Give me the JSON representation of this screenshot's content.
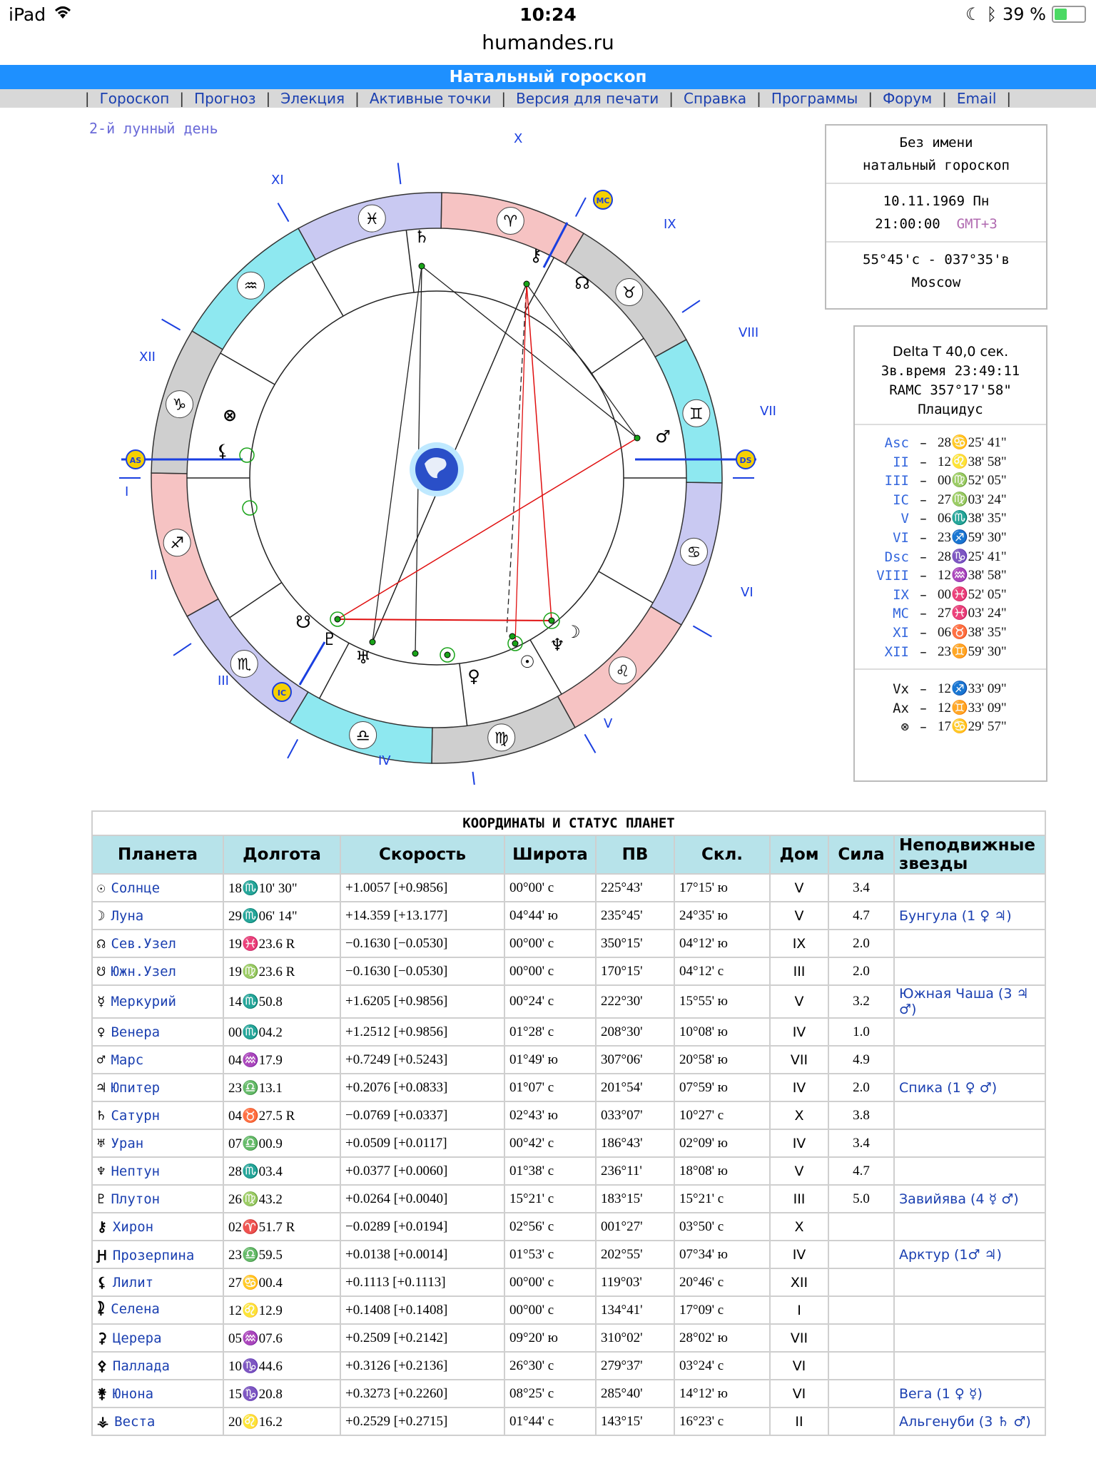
{
  "status_bar": {
    "device": "iPad",
    "time": "10:24",
    "battery": "39 %",
    "battery_level": 0.39
  },
  "browser": {
    "url": "humandes.ru"
  },
  "page": {
    "title": "Натальный гороскоп"
  },
  "nav": [
    "Гороскоп",
    "Прогноз",
    "Элекция",
    "Активные точки",
    "Версия для печати",
    "Справка",
    "Программы",
    "Форум",
    "Email"
  ],
  "lunar_day": "2-й лунный день",
  "info": {
    "name": "Без имени",
    "chart_type": "натальный гороскоп",
    "date": "10.11.1969 Пн",
    "time": "21:00:00",
    "tz": "GMT+3",
    "coords": "55°45'с - 037°35'в",
    "city": "Moscow"
  },
  "houses_panel": {
    "delta_t": "Delta T   40,0 сек.",
    "sidereal": "Зв.время 23:49:11",
    "ramc": "RAMC 357°17'58\"",
    "system": "Плацидус",
    "cusps": [
      {
        "name": "Asc",
        "deg": "28",
        "sign": "♋",
        "min": "25' 41\""
      },
      {
        "name": "II",
        "deg": "12",
        "sign": "♌",
        "min": "38' 58\""
      },
      {
        "name": "III",
        "deg": "00",
        "sign": "♍",
        "min": "52' 05\""
      },
      {
        "name": "IC",
        "deg": "27",
        "sign": "♍",
        "min": "03' 24\""
      },
      {
        "name": "V",
        "deg": "06",
        "sign": "♏",
        "min": "38' 35\""
      },
      {
        "name": "VI",
        "deg": "23",
        "sign": "♐",
        "min": "59' 30\""
      },
      {
        "name": "Dsc",
        "deg": "28",
        "sign": "♑",
        "min": "25' 41\""
      },
      {
        "name": "VIII",
        "deg": "12",
        "sign": "♒",
        "min": "38' 58\""
      },
      {
        "name": "IX",
        "deg": "00",
        "sign": "♓",
        "min": "52' 05\""
      },
      {
        "name": "MC",
        "deg": "27",
        "sign": "♓",
        "min": "03' 24\""
      },
      {
        "name": "XI",
        "deg": "06",
        "sign": "♉",
        "min": "38' 35\""
      },
      {
        "name": "XII",
        "deg": "23",
        "sign": "♊",
        "min": "59' 30\""
      }
    ],
    "points": [
      {
        "name": "Vx",
        "deg": "12",
        "sign": "♐",
        "min": "33' 09\""
      },
      {
        "name": "Ax",
        "deg": "12",
        "sign": "♊",
        "min": "33' 09\""
      },
      {
        "name": "⊗",
        "deg": "17",
        "sign": "♋",
        "min": "29' 57\""
      }
    ]
  },
  "chart": {
    "houses": [
      "I",
      "II",
      "III",
      "IV",
      "V",
      "VI",
      "VII",
      "VIII",
      "IX",
      "X",
      "XI",
      "XII"
    ],
    "angles": [
      "AS",
      "IC",
      "DS",
      "MC"
    ],
    "zodiac": [
      "♈",
      "♉",
      "♊",
      "♋",
      "♌",
      "♍",
      "♎",
      "♏",
      "♐",
      "♑",
      "♒",
      "♓"
    ],
    "planet_glyphs": [
      "♄",
      "⚷",
      "☊",
      "♂",
      "☽",
      "♆",
      "☉",
      "♀",
      "♅",
      "♇",
      "☋",
      "⚸",
      "⊗"
    ]
  },
  "table": {
    "caption": "КООРДИНАТЫ И СТАТУС ПЛАНЕТ",
    "headers": [
      "Планета",
      "Долгота",
      "Скорость",
      "Широта",
      "ПВ",
      "Скл.",
      "Дом",
      "Сила",
      "Неподвижные звезды"
    ],
    "rows": [
      {
        "glyph": "☉",
        "name": "Солнце",
        "lon": "18♏10' 30\"",
        "speed": "+1.0057  [+0.9856]",
        "lat": "00°00' с",
        "ra": "225°43'",
        "decl": "17°15' ю",
        "house": "V",
        "power": "3.4",
        "star": ""
      },
      {
        "glyph": "☽",
        "name": "Луна",
        "lon": "29♏06' 14\"",
        "speed": "+14.359  [+13.177]",
        "lat": "04°44' ю",
        "ra": "235°45'",
        "decl": "24°35' ю",
        "house": "V",
        "power": "4.7",
        "star": "Бунгула (1 ♀ ♃)"
      },
      {
        "glyph": "☊",
        "name": "Сев.Узел",
        "lon": "19♓23.6  R",
        "speed": "−0.1630  [−0.0530]",
        "lat": "00°00' с",
        "ra": "350°15'",
        "decl": "04°12' ю",
        "house": "IX",
        "power": "2.0",
        "star": ""
      },
      {
        "glyph": "☋",
        "name": "Южн.Узел",
        "lon": "19♍23.6  R",
        "speed": "−0.1630  [−0.0530]",
        "lat": "00°00' с",
        "ra": "170°15'",
        "decl": "04°12' с",
        "house": "III",
        "power": "2.0",
        "star": ""
      },
      {
        "glyph": "☿",
        "name": "Меркурий",
        "lon": "14♏50.8",
        "speed": "+1.6205  [+0.9856]",
        "lat": "00°24' с",
        "ra": "222°30'",
        "decl": "15°55' ю",
        "house": "V",
        "power": "3.2",
        "star": "Южная Чаша (3 ♃ ♂)"
      },
      {
        "glyph": "♀",
        "name": "Венера",
        "lon": "00♏04.2",
        "speed": "+1.2512  [+0.9856]",
        "lat": "01°28' с",
        "ra": "208°30'",
        "decl": "10°08' ю",
        "house": "IV",
        "power": "1.0",
        "star": ""
      },
      {
        "glyph": "♂",
        "name": "Марс",
        "lon": "04♒17.9",
        "speed": "+0.7249  [+0.5243]",
        "lat": "01°49' ю",
        "ra": "307°06'",
        "decl": "20°58' ю",
        "house": "VII",
        "power": "4.9",
        "star": ""
      },
      {
        "glyph": "♃",
        "name": "Юпитер",
        "lon": "23♎13.1",
        "speed": "+0.2076  [+0.0833]",
        "lat": "01°07' с",
        "ra": "201°54'",
        "decl": "07°59' ю",
        "house": "IV",
        "power": "2.0",
        "star": "Спика (1 ♀ ♂)"
      },
      {
        "glyph": "♄",
        "name": "Сатурн",
        "lon": "04♉27.5  R",
        "speed": "−0.0769  [+0.0337]",
        "lat": "02°43' ю",
        "ra": "033°07'",
        "decl": "10°27' с",
        "house": "X",
        "power": "3.8",
        "star": ""
      },
      {
        "glyph": "♅",
        "name": "Уран",
        "lon": "07♎00.9",
        "speed": "+0.0509  [+0.0117]",
        "lat": "00°42' с",
        "ra": "186°43'",
        "decl": "02°09' ю",
        "house": "IV",
        "power": "3.4",
        "star": ""
      },
      {
        "glyph": "♆",
        "name": "Нептун",
        "lon": "28♏03.4",
        "speed": "+0.0377  [+0.0060]",
        "lat": "01°38' с",
        "ra": "236°11'",
        "decl": "18°08' ю",
        "house": "V",
        "power": "4.7",
        "star": ""
      },
      {
        "glyph": "♇",
        "name": "Плутон",
        "lon": "26♍43.2",
        "speed": "+0.0264  [+0.0040]",
        "lat": "15°21' с",
        "ra": "183°15'",
        "decl": "15°21' с",
        "house": "III",
        "power": "5.0",
        "star": "Завийява (4 ☿ ♂)"
      },
      {
        "glyph": "⚷",
        "name": "Хирон",
        "lon": "02♈51.7  R",
        "speed": "−0.0289  [+0.0194]",
        "lat": "02°56' с",
        "ra": "001°27'",
        "decl": "03°50' с",
        "house": "X",
        "power": "",
        "star": ""
      },
      {
        "glyph": "Ԩ",
        "name": "Прозерпина",
        "lon": "23♎59.5",
        "speed": "+0.0138  [+0.0014]",
        "lat": "01°53' с",
        "ra": "202°55'",
        "decl": "07°34' ю",
        "house": "IV",
        "power": "",
        "star": "Арктур (1♂ ♃)"
      },
      {
        "glyph": "⚸",
        "name": "Лилит",
        "lon": "27♋00.4",
        "speed": "+0.1113  [+0.1113]",
        "lat": "00°00' с",
        "ra": "119°03'",
        "decl": "20°46' с",
        "house": "XII",
        "power": "",
        "star": ""
      },
      {
        "glyph": "⯝",
        "name": "Селена",
        "lon": "12♌12.9",
        "speed": "+0.1408  [+0.1408]",
        "lat": "00°00' с",
        "ra": "134°41'",
        "decl": "17°09' с",
        "house": "I",
        "power": "",
        "star": ""
      },
      {
        "glyph": "⚳",
        "name": "Церера",
        "lon": "05♒07.6",
        "speed": "+0.2509  [+0.2142]",
        "lat": "09°20' ю",
        "ra": "310°02'",
        "decl": "28°02' ю",
        "house": "VII",
        "power": "",
        "star": ""
      },
      {
        "glyph": "⚴",
        "name": "Паллада",
        "lon": "10♑44.6",
        "speed": "+0.3126  [+0.2136]",
        "lat": "26°30' с",
        "ra": "279°37'",
        "decl": "03°24' с",
        "house": "VI",
        "power": "",
        "star": ""
      },
      {
        "glyph": "⚵",
        "name": "Юнона",
        "lon": "15♑20.8",
        "speed": "+0.3273  [+0.2260]",
        "lat": "08°25' с",
        "ra": "285°40'",
        "decl": "14°12' ю",
        "house": "VI",
        "power": "",
        "star": "Вега (1 ♀ ☿)"
      },
      {
        "glyph": "⚶",
        "name": "Веста",
        "lon": "20♌16.2",
        "speed": "+0.2529  [+0.2715]",
        "lat": "01°44' с",
        "ra": "143°15'",
        "decl": "16°23' с",
        "house": "II",
        "power": "",
        "star": "Альгенуби (3 ♄ ♂)"
      }
    ]
  }
}
